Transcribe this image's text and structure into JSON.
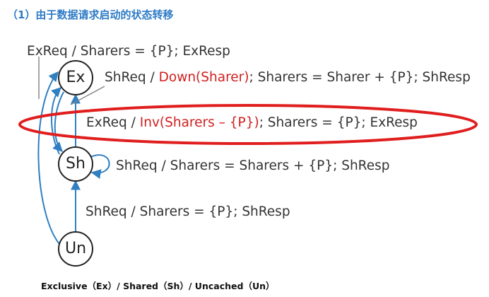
{
  "heading": "（1）由于数据请求启动的状态转移",
  "states": {
    "ex": "Ex",
    "sh": "Sh",
    "un": "Un"
  },
  "transitions": {
    "exreq_top": "ExReq / Sharers = {P}; ExResp",
    "shreq_ex": {
      "part1": "ShReq / ",
      "red": "Down(Sharer)",
      "part2": "; Sharers = Sharer + {P}; ShResp"
    },
    "exreq_sh": {
      "part1": "ExReq / ",
      "red": "Inv(Sharers – {P})",
      "part2": "; Sharers = {P}; ExResp"
    },
    "shreq_self": "ShReq / Sharers = Sharers + {P}; ShResp",
    "shreq_un": "ShReq / Sharers = {P}; ShResp"
  },
  "caption": "Exclusive（Ex）/ Shared（Sh）/ Uncached（Un）",
  "colors": {
    "heading": "#2e7bc6",
    "arrow": "#2f7fc1",
    "highlight_ellipse": "#e01e1e",
    "red_text": "#d01f1f",
    "state_outline": "#222222"
  }
}
